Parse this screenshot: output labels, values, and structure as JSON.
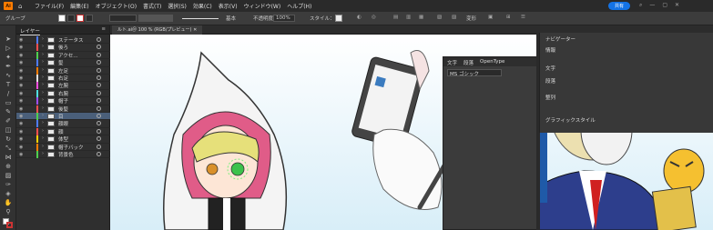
{
  "menu": {
    "app_icon": "Ai",
    "home_icon": "home-icon",
    "items": [
      "ファイル(F)",
      "編集(E)",
      "オブジェクト(O)",
      "書式(T)",
      "選択(S)",
      "効果(C)",
      "表示(V)",
      "ウィンドウ(W)",
      "ヘルプ(H)"
    ],
    "share_label": "共有"
  },
  "control": {
    "selection_label": "グループ",
    "stroke_label": "基本",
    "opacity_label": "不透明度：",
    "opacity_value": "100%",
    "style_label": "スタイル：",
    "transform_label": "変形"
  },
  "layers_panel": {
    "tab_label": "レイヤー",
    "rows": [
      {
        "name": "ステータス",
        "color": "#4f7cff",
        "selected": false
      },
      {
        "name": "後ろ",
        "color": "#ff4f4f",
        "selected": false
      },
      {
        "name": "アクセ...",
        "color": "#4fce4f",
        "selected": false
      },
      {
        "name": "髪",
        "color": "#4f7cff",
        "selected": false
      },
      {
        "name": "左足",
        "color": "#ff7c00",
        "selected": false
      },
      {
        "name": "右足",
        "color": "#e0e0e0",
        "selected": false
      },
      {
        "name": "左腕",
        "color": "#ff4fe0",
        "selected": false
      },
      {
        "name": "右腕",
        "color": "#4fe0e0",
        "selected": false
      },
      {
        "name": "帽子",
        "color": "#a04fff",
        "selected": false
      },
      {
        "name": "後髪",
        "color": "#ff4f4f",
        "selected": false
      },
      {
        "name": "目",
        "color": "#4fce4f",
        "selected": true
      },
      {
        "name": "顔眼",
        "color": "#4f7cff",
        "selected": false
      },
      {
        "name": "顔",
        "color": "#ff4f4f",
        "selected": false
      },
      {
        "name": "体型",
        "color": "#ffd400",
        "selected": false
      },
      {
        "name": "帽子バック",
        "color": "#ff7c00",
        "selected": false
      },
      {
        "name": "背景色",
        "color": "#4fce4f",
        "selected": false
      }
    ]
  },
  "document": {
    "tab_label": "ルト.ai＠ 100 % (RGB/プレビュー)"
  },
  "character_panel": {
    "tabs": [
      "文字",
      "段落",
      "OpenType"
    ],
    "font_name": "MS ゴシック"
  },
  "right_panels": {
    "items": [
      "ナビゲーター",
      "情報",
      "文字",
      "段落",
      "整列",
      "グラフィックスタイル"
    ]
  },
  "colors": {
    "accent": "#1473e6",
    "ai_orange": "#ff7c00",
    "selection": "#4a5f7a"
  }
}
